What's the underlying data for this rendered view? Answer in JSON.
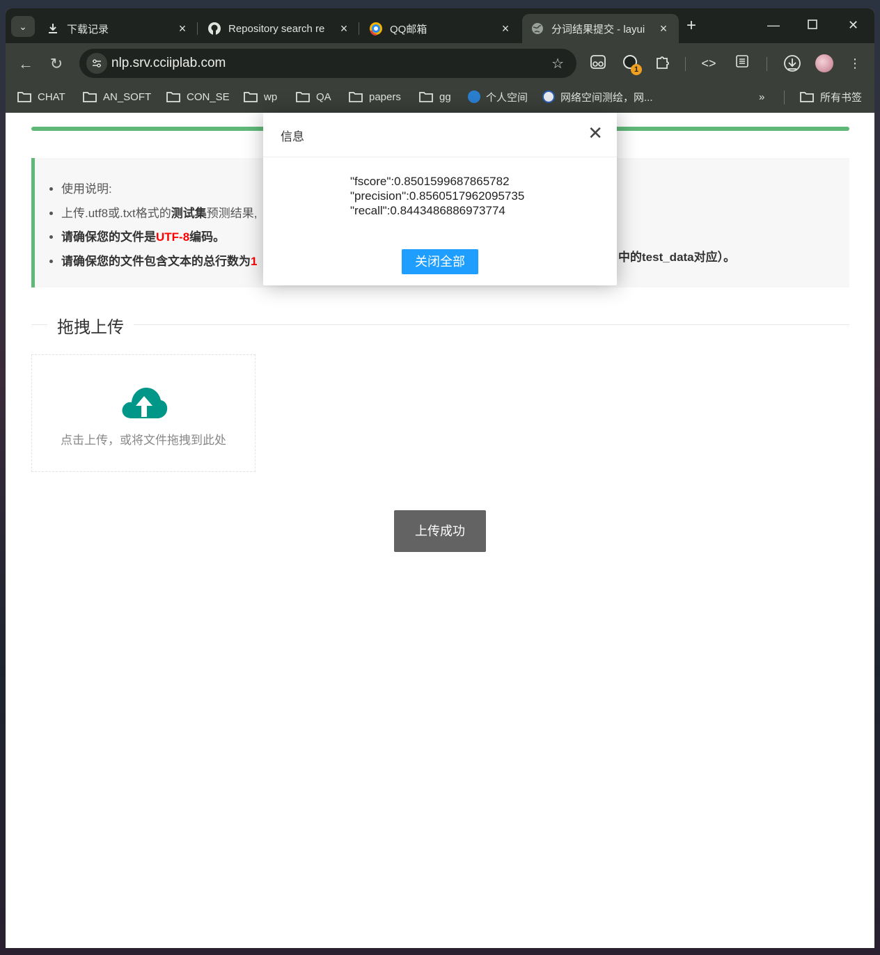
{
  "browser": {
    "tabs": [
      {
        "title": "下载记录",
        "icon": "download-icon"
      },
      {
        "title": "Repository search re",
        "icon": "github-icon"
      },
      {
        "title": "QQ邮箱",
        "icon": "qq-mail-icon"
      },
      {
        "title": "分词结果提交 - layui",
        "icon": "globe-icon",
        "active": true
      }
    ],
    "url": "nlp.srv.cciiplab.com",
    "extension_badge": "1",
    "bookmarks": [
      "CHAT",
      "AN_SOFT",
      "CON_SE",
      "wp",
      "QA",
      "papers",
      "gg",
      "个人空间",
      "网络空间测绘，网..."
    ],
    "bookmarks_overflow": "»",
    "all_bookmarks": "所有书签"
  },
  "page": {
    "notice": {
      "items": [
        {
          "text": "使用说明:"
        },
        {
          "pre": "上传.utf8或.txt格式的",
          "bold": "测试集",
          "post": "预测结果,"
        },
        {
          "bold_pre": "请确保您的文件是",
          "red": "UTF-8",
          "bold_post": "编码。"
        },
        {
          "bold_pre": "请确保您的文件包含文本的总行数为",
          "red": "1"
        }
      ],
      "tail_text": "中的test_data对应）。"
    },
    "drag_upload": {
      "title": "拖拽上传",
      "hint": "点击上传，或将文件拖拽到此处",
      "icon": "cloud-upload-icon"
    },
    "upload_button": "上传成功"
  },
  "modal": {
    "title": "信息",
    "lines": [
      "\"fscore\":0.8501599687865782",
      "\"precision\":0.8560517962095735",
      "\"recall\":0.8443486886973774"
    ],
    "button": "关闭全部"
  },
  "colors": {
    "accent_green": "#5fb878",
    "button_blue": "#1e9fff",
    "upload_gray": "#636363",
    "cloud_teal": "#009688",
    "warning_red": "#ff0000"
  }
}
